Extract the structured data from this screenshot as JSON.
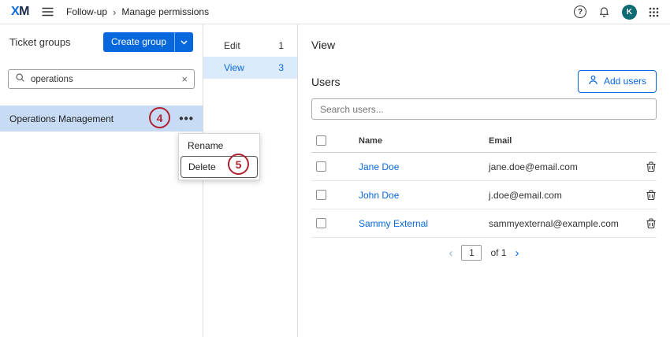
{
  "topbar": {
    "logo_x": "X",
    "logo_m": "M",
    "breadcrumb": {
      "items": [
        "Follow-up",
        "Manage permissions"
      ],
      "separator": "›"
    },
    "avatar_initial": "K"
  },
  "icons": {
    "help": "?",
    "more": "•••",
    "clear": "×",
    "prev": "‹",
    "next": "›"
  },
  "left_panel": {
    "title": "Ticket groups",
    "create_group_label": "Create group",
    "search_value": "operations",
    "group_name": "Operations Management",
    "context_menu": {
      "rename_label": "Rename",
      "delete_label": "Delete"
    }
  },
  "permission_list": {
    "items": [
      {
        "label": "Edit",
        "count": "1"
      },
      {
        "label": "View",
        "count": "3"
      }
    ]
  },
  "main": {
    "title": "View",
    "users": {
      "title": "Users",
      "add_button_label": "Add users",
      "search_placeholder": "Search users...",
      "table": {
        "name_header": "Name",
        "email_header": "Email",
        "rows": [
          {
            "name": "Jane Doe",
            "email": "jane.doe@email.com"
          },
          {
            "name": "John Doe",
            "email": "j.doe@email.com"
          },
          {
            "name": "Sammy External",
            "email": "sammyexternal@example.com"
          }
        ]
      },
      "pagination": {
        "current_page": "1",
        "of_label": "of 1"
      }
    }
  },
  "annotations": {
    "step4": "4",
    "step5": "5"
  },
  "colors": {
    "accent_blue": "#0768dd",
    "selected_group_bg": "#c7dcf4",
    "selected_list_bg": "#dcebfb",
    "annotation_red": "#b0212f",
    "avatar_teal": "#0e6b74"
  }
}
